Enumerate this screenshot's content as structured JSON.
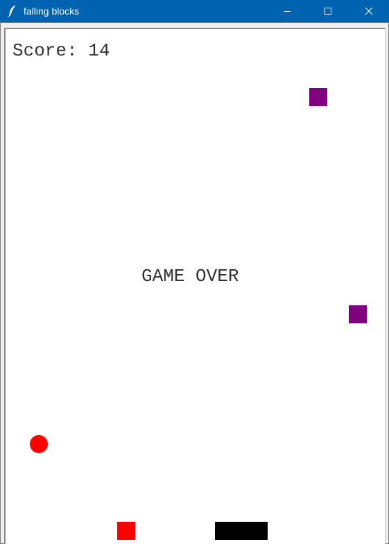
{
  "window": {
    "title": "falling blocks",
    "titlebar_color": "#0063b1",
    "icons": {
      "app": "feather-icon",
      "minimize": "minimize-icon",
      "maximize": "maximize-icon",
      "close": "close-icon"
    }
  },
  "game": {
    "score_text": "Score: 14",
    "status_text": "GAME OVER",
    "colors": {
      "purple_block": "#800080",
      "red": "#ff0000",
      "paddle": "#000000",
      "background": "#ffffff"
    }
  }
}
